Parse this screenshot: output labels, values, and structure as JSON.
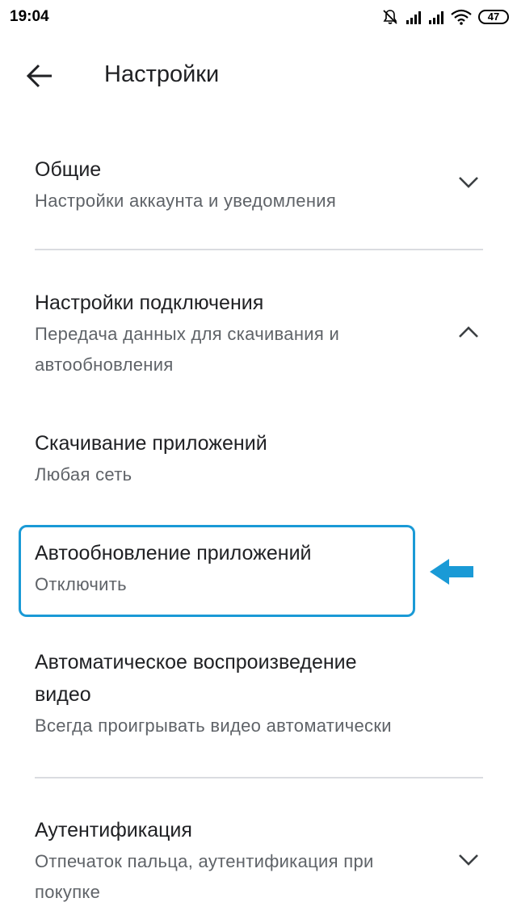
{
  "status_bar": {
    "time": "19:04",
    "battery": "47",
    "icons": [
      "mute-icon",
      "signal-icon",
      "signal-icon",
      "wifi-icon",
      "battery-icon"
    ]
  },
  "header": {
    "back_icon": "arrow-left-icon",
    "title": "Настройки"
  },
  "sections": {
    "general": {
      "title": "Общие",
      "subtitle": "Настройки аккаунта и уведомления",
      "chevron": "chevron-down-icon"
    },
    "network": {
      "title": "Настройки подключения",
      "subtitle_line1": "Передача данных для скачивания и",
      "subtitle_line2": "автообновления",
      "chevron": "chevron-up-icon"
    },
    "app_download": {
      "title": "Скачивание приложений",
      "subtitle": "Любая сеть"
    },
    "auto_update": {
      "title": "Автообновление приложений",
      "subtitle": "Отключить"
    },
    "autoplay": {
      "title_line1": "Автоматическое воспроизведение",
      "title_line2": "видео",
      "subtitle": "Всегда проигрывать видео автоматически"
    },
    "auth": {
      "title": "Аутентификация",
      "subtitle_line1": "Отпечаток пальца, аутентификация при",
      "subtitle_line2": "покупке",
      "chevron": "chevron-down-icon"
    }
  },
  "annotation": {
    "highlight_color": "#1a9ad6",
    "arrow_color": "#1a9ad6"
  }
}
